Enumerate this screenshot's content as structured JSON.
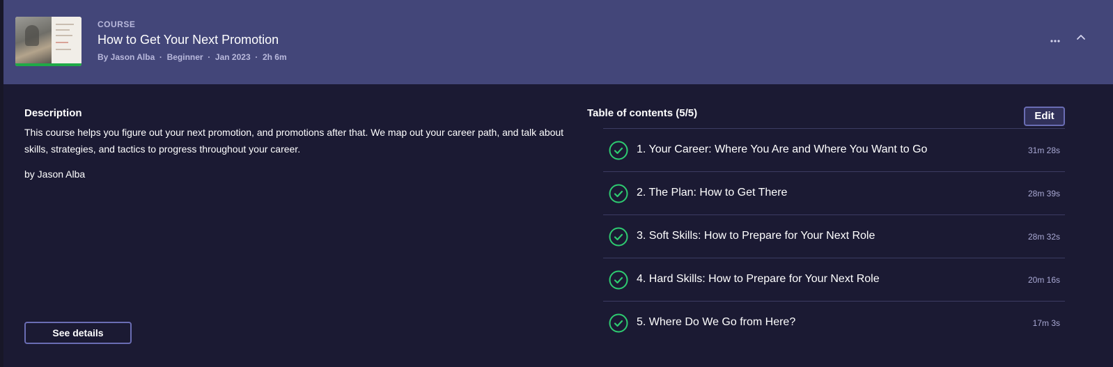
{
  "header": {
    "label": "COURSE",
    "title": "How to Get Your Next Promotion",
    "meta": "By Jason Alba  ·  Beginner  ·  Jan 2023  ·  2h 6m",
    "more_icon": "more-horizontal-icon",
    "collapse_icon": "chevron-up-icon"
  },
  "description": {
    "heading": "Description",
    "text": "This course helps you figure out your next promotion, and promotions after that. We map out your career path, and talk about skills, strategies, and tactics to progress throughout your career.",
    "byline": "by Jason Alba",
    "see_details_label": "See details"
  },
  "toc": {
    "heading": "Table of contents (5/5)",
    "edit_label": "Edit",
    "items": [
      {
        "title": "1. Your Career: Where You Are and Where You Want to Go",
        "duration": "31m 28s",
        "completed": true
      },
      {
        "title": "2. The Plan: How to Get There",
        "duration": "28m 39s",
        "completed": true
      },
      {
        "title": "3. Soft Skills: How to Prepare for Your Next Role",
        "duration": "28m 32s",
        "completed": true
      },
      {
        "title": "4. Hard Skills: How to Prepare for Your Next Role",
        "duration": "20m 16s",
        "completed": true
      },
      {
        "title": "5. Where Do We Go from Here?",
        "duration": "17m 3s",
        "completed": true
      }
    ]
  },
  "colors": {
    "header_bg": "#434679",
    "body_bg": "#1b1a33",
    "accent_green": "#2ecc71",
    "button_border": "#6a6db4"
  }
}
